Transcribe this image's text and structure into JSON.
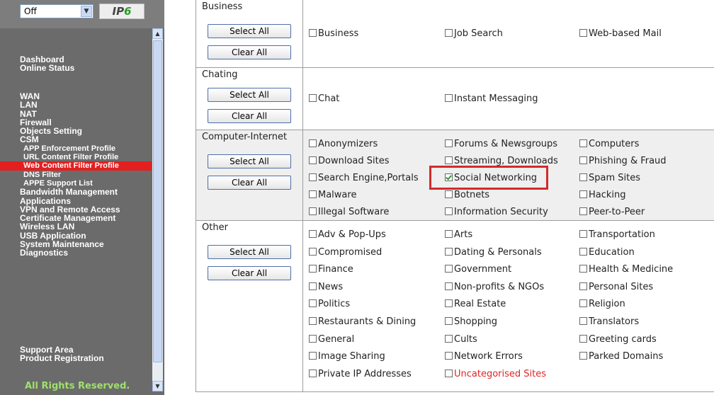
{
  "sidebar": {
    "mode_select": "Off",
    "logo_text": "IPv6",
    "menu_primary": [
      "Dashboard",
      "Online Status"
    ],
    "menu_main": [
      {
        "label": "WAN",
        "type": "it"
      },
      {
        "label": "LAN",
        "type": "it"
      },
      {
        "label": "NAT",
        "type": "it"
      },
      {
        "label": "Firewall",
        "type": "it"
      },
      {
        "label": "Objects Setting",
        "type": "it"
      },
      {
        "label": "CSM",
        "type": "it"
      },
      {
        "label": "APP Enforcement Profile",
        "type": "sub"
      },
      {
        "label": "URL Content Filter Profile",
        "type": "sub"
      },
      {
        "label": "Web Content Filter Profile",
        "type": "sub",
        "active": true
      },
      {
        "label": "DNS Filter",
        "type": "sub"
      },
      {
        "label": "APPE Support List",
        "type": "sub"
      },
      {
        "label": "Bandwidth Management",
        "type": "it"
      },
      {
        "label": "Applications",
        "type": "it"
      },
      {
        "label": "VPN and Remote Access",
        "type": "it"
      },
      {
        "label": "Certificate Management",
        "type": "it"
      },
      {
        "label": "Wireless LAN",
        "type": "it"
      },
      {
        "label": "USB Application",
        "type": "it"
      },
      {
        "label": "System Maintenance",
        "type": "it"
      },
      {
        "label": "Diagnostics",
        "type": "it"
      }
    ],
    "menu_bottom": [
      "Support Area",
      "Product Registration"
    ],
    "footer": "All Rights Reserved."
  },
  "buttons": {
    "select_all": "Select All",
    "clear_all": "Clear All"
  },
  "groups": [
    {
      "name": "Business",
      "items": [
        {
          "label": "Business",
          "checked": false
        },
        {
          "label": "Job Search",
          "checked": false
        },
        {
          "label": "Web-based Mail",
          "checked": false
        }
      ]
    },
    {
      "name": "Chating",
      "items": [
        {
          "label": "Chat",
          "checked": false
        },
        {
          "label": "Instant Messaging",
          "checked": false
        }
      ]
    },
    {
      "name": "Computer-Internet",
      "items": [
        {
          "label": "Anonymizers",
          "checked": false
        },
        {
          "label": "Forums & Newsgroups",
          "checked": false
        },
        {
          "label": "Computers",
          "checked": false
        },
        {
          "label": "Download Sites",
          "checked": false
        },
        {
          "label": "Streaming, Downloads",
          "checked": false
        },
        {
          "label": "Phishing & Fraud",
          "checked": false
        },
        {
          "label": "Search Engine,Portals",
          "checked": false
        },
        {
          "label": "Social Networking",
          "checked": true
        },
        {
          "label": "Spam Sites",
          "checked": false
        },
        {
          "label": "Malware",
          "checked": false
        },
        {
          "label": "Botnets",
          "checked": false
        },
        {
          "label": "Hacking",
          "checked": false
        },
        {
          "label": "Illegal Software",
          "checked": false
        },
        {
          "label": "Information Security",
          "checked": false
        },
        {
          "label": "Peer-to-Peer",
          "checked": false
        }
      ]
    },
    {
      "name": "Other",
      "items": [
        {
          "label": "Adv & Pop-Ups",
          "checked": false
        },
        {
          "label": "Arts",
          "checked": false
        },
        {
          "label": "Transportation",
          "checked": false
        },
        {
          "label": "Compromised",
          "checked": false
        },
        {
          "label": "Dating & Personals",
          "checked": false
        },
        {
          "label": "Education",
          "checked": false
        },
        {
          "label": "Finance",
          "checked": false
        },
        {
          "label": "Government",
          "checked": false
        },
        {
          "label": "Health & Medicine",
          "checked": false
        },
        {
          "label": "News",
          "checked": false
        },
        {
          "label": "Non-profits & NGOs",
          "checked": false
        },
        {
          "label": "Personal Sites",
          "checked": false
        },
        {
          "label": "Politics",
          "checked": false
        },
        {
          "label": "Real Estate",
          "checked": false
        },
        {
          "label": "Religion",
          "checked": false
        },
        {
          "label": "Restaurants & Dining",
          "checked": false
        },
        {
          "label": "Shopping",
          "checked": false
        },
        {
          "label": "Translators",
          "checked": false
        },
        {
          "label": "General",
          "checked": false
        },
        {
          "label": "Cults",
          "checked": false
        },
        {
          "label": "Greeting cards",
          "checked": false
        },
        {
          "label": "Image Sharing",
          "checked": false
        },
        {
          "label": "Network Errors",
          "checked": false
        },
        {
          "label": "Parked Domains",
          "checked": false
        },
        {
          "label": "Private IP Addresses",
          "checked": false
        },
        {
          "label": "Uncategorised Sites",
          "checked": false,
          "highlight_color": "#e02424"
        }
      ]
    }
  ],
  "colors": {
    "active_menu": "#e41f1f",
    "annotation_box": "#d22b2b",
    "footer_text": "#9fe16b"
  }
}
